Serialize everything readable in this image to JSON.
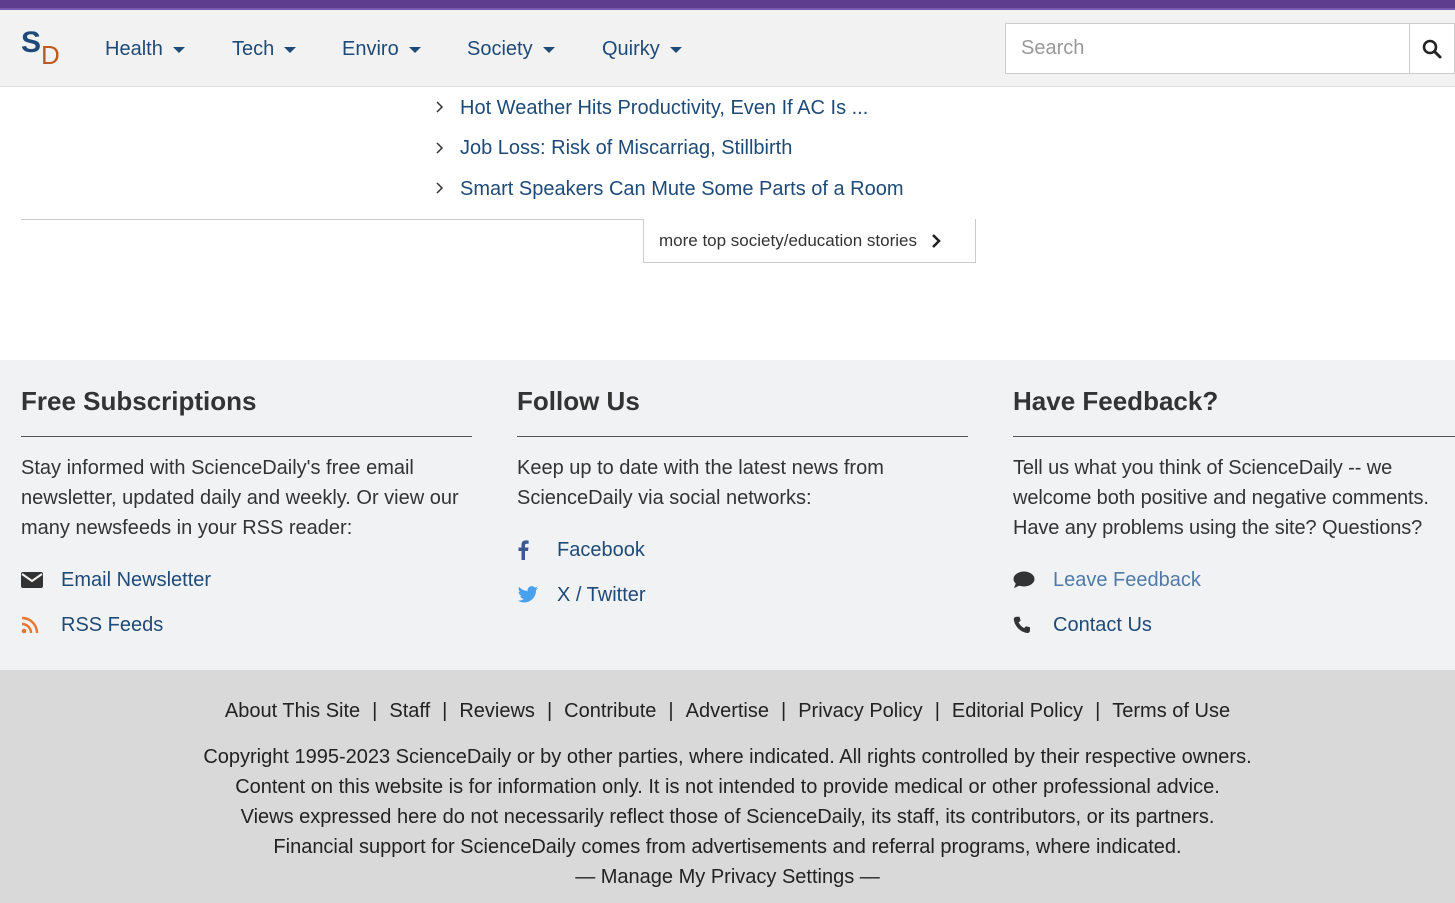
{
  "colors": {
    "brand_purple": "#5e3c8e",
    "link_blue": "#1e4a78",
    "rss_orange": "#e8772e",
    "twitter_blue": "#4aa1eb"
  },
  "logo": {
    "s": "S",
    "d": "D"
  },
  "nav": {
    "items": [
      {
        "label": "Health"
      },
      {
        "label": "Tech"
      },
      {
        "label": "Enviro"
      },
      {
        "label": "Society"
      },
      {
        "label": "Quirky"
      }
    ]
  },
  "search": {
    "placeholder": "Search",
    "icon": "search-icon"
  },
  "stories": [
    {
      "title": "Hot Weather Hits Productivity, Even If AC Is ..."
    },
    {
      "title": "Job Loss: Risk of Miscarriag, Stillbirth"
    },
    {
      "title": "Smart Speakers Can Mute Some Parts of a Room"
    }
  ],
  "more_button": {
    "label": "more top society/education stories"
  },
  "footer": {
    "subscriptions": {
      "heading": "Free Subscriptions",
      "text": "Stay informed with ScienceDaily's free email newsletter, updated daily and weekly. Or view our many newsfeeds in your RSS reader:",
      "links": [
        {
          "label": "Email Newsletter",
          "icon": "envelope-icon"
        },
        {
          "label": "RSS Feeds",
          "icon": "rss-icon"
        }
      ]
    },
    "follow": {
      "heading": "Follow Us",
      "text": "Keep up to date with the latest news from ScienceDaily via social networks:",
      "links": [
        {
          "label": "Facebook",
          "icon": "facebook-icon"
        },
        {
          "label": "X / Twitter",
          "icon": "twitter-icon"
        }
      ]
    },
    "feedback": {
      "heading": "Have Feedback?",
      "text": "Tell us what you think of ScienceDaily -- we welcome both positive and negative comments. Have any problems using the site? Questions?",
      "links": [
        {
          "label": "Leave Feedback",
          "icon": "comment-icon"
        },
        {
          "label": "Contact Us",
          "icon": "phone-icon"
        }
      ]
    },
    "bottom_links": [
      "About This Site",
      "Staff",
      "Reviews",
      "Contribute",
      "Advertise",
      "Privacy Policy",
      "Editorial Policy",
      "Terms of Use"
    ],
    "separator": "|",
    "copyright": [
      "Copyright 1995-2023 ScienceDaily or by other parties, where indicated. All rights controlled by their respective owners.",
      "Content on this website is for information only. It is not intended to provide medical or other professional advice.",
      "Views expressed here do not necessarily reflect those of ScienceDaily, its staff, its contributors, or its partners.",
      "Financial support for ScienceDaily comes from advertisements and referral programs, where indicated."
    ],
    "privacy_settings": "— Manage My Privacy Settings —"
  }
}
